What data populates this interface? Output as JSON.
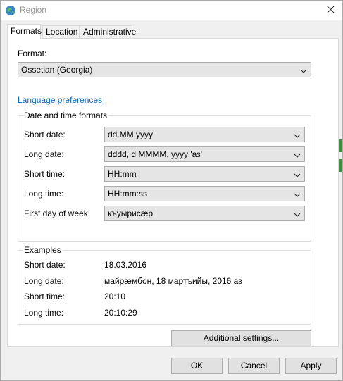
{
  "window": {
    "title": "Region",
    "icon": "globe-icon"
  },
  "tabs": [
    {
      "label": "Formats",
      "active": true
    },
    {
      "label": "Location",
      "active": false
    },
    {
      "label": "Administrative",
      "active": false
    }
  ],
  "format": {
    "label": "Format:",
    "value": "Ossetian (Georgia)"
  },
  "language_link": "Language preferences",
  "datetime": {
    "title": "Date and time formats",
    "rows": [
      {
        "label": "Short date:",
        "value": "dd.MM.yyyy"
      },
      {
        "label": "Long date:",
        "value": "dddd, d MMMM, yyyy 'аз'"
      },
      {
        "label": "Short time:",
        "value": "HH:mm"
      },
      {
        "label": "Long time:",
        "value": "HH:mm:ss"
      },
      {
        "label": "First day of week:",
        "value": "къуырисæр"
      }
    ]
  },
  "examples": {
    "title": "Examples",
    "rows": [
      {
        "label": "Short date:",
        "value": "18.03.2016"
      },
      {
        "label": "Long date:",
        "value": "майрæмбон, 18 мартъийы, 2016 аз"
      },
      {
        "label": "Short time:",
        "value": "20:10"
      },
      {
        "label": "Long time:",
        "value": "20:10:29"
      }
    ]
  },
  "buttons": {
    "additional": "Additional settings...",
    "ok": "OK",
    "cancel": "Cancel",
    "apply": "Apply"
  },
  "colors": {
    "link": "#0066cc",
    "accent_edge": "#3c8d3c"
  }
}
